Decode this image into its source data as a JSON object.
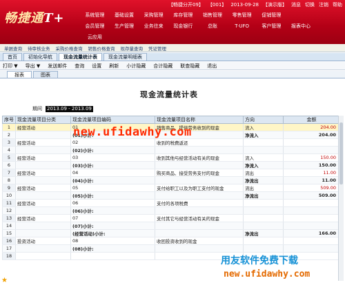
{
  "header": {
    "logo": "畅捷通",
    "logo_mark": "T+",
    "info": [
      "【畅捷分开09】",
      "【001】",
      "2013-09-28",
      "【演示版】",
      "消息",
      "切换",
      "注销",
      "帮助"
    ],
    "menu": [
      "系统管理",
      "基础设置",
      "采购管理",
      "库存管理",
      "销售管理",
      "零售管理",
      "促销管理",
      "会员管理",
      "生产管理",
      "业务往来",
      "现金银行",
      "总账",
      "T-UFO",
      "客户管理",
      "报表中心",
      "云应用"
    ]
  },
  "quick_links": [
    "单据查询",
    "待审核业务",
    "采购价格查询",
    "销售价格查询",
    "现存量查询",
    "凭证管理"
  ],
  "tabs": [
    "首页",
    "初始化导航",
    "现金流量统计表",
    "现金流量明细表"
  ],
  "active_tab": "现金流量统计表",
  "toolbar": {
    "print": "打印",
    "export": "导出",
    "send_mail": "发送邮件",
    "query": "查询",
    "settings": "设置",
    "refresh": "刷新",
    "hide_subtotal": "小计隐藏",
    "hide_total": "合计隐藏",
    "linked_query": "联查隐藏",
    "exit": "退出"
  },
  "view_tabs": [
    "报表",
    "图表"
  ],
  "report": {
    "title": "现金流量统计表",
    "period_label": "期间",
    "period_value": "2013.09 - 2013.09",
    "columns": [
      "序号",
      "现金流量项目分类",
      "现金流量项目编码",
      "现金流量项目名称",
      "方向",
      "金额"
    ],
    "rows": [
      {
        "seq": "1",
        "cat": "经营活动",
        "code": "01",
        "name": "销售商品、提供劳务收到的现金",
        "dir": "流入",
        "amt": "204.00",
        "type": "sel"
      },
      {
        "seq": "2",
        "cat": "",
        "code": "(01)小计:",
        "name": "",
        "dir": "净流入",
        "amt": "204.00",
        "type": "sub"
      },
      {
        "seq": "3",
        "cat": "经营活动",
        "code": "02",
        "name": "收到的税费返还",
        "dir": "",
        "amt": "",
        "type": "row"
      },
      {
        "seq": "4",
        "cat": "",
        "code": "(02)小计:",
        "name": "",
        "dir": "",
        "amt": "",
        "type": "sub"
      },
      {
        "seq": "5",
        "cat": "经营活动",
        "code": "03",
        "name": "收到其他与经营活动有关的现金",
        "dir": "流入",
        "amt": "150.00",
        "type": "row"
      },
      {
        "seq": "6",
        "cat": "",
        "code": "(03)小计:",
        "name": "",
        "dir": "净流入",
        "amt": "150.00",
        "type": "sub"
      },
      {
        "seq": "7",
        "cat": "经营活动",
        "code": "04",
        "name": "购买商品、接受劳务支付的现金",
        "dir": "流出",
        "amt": "11.00",
        "type": "row"
      },
      {
        "seq": "8",
        "cat": "",
        "code": "(04)小计:",
        "name": "",
        "dir": "净流出",
        "amt": "11.00",
        "type": "sub"
      },
      {
        "seq": "9",
        "cat": "经营活动",
        "code": "05",
        "name": "支付给职工以及为职工支付的现金",
        "dir": "流出",
        "amt": "509.00",
        "type": "row"
      },
      {
        "seq": "10",
        "cat": "",
        "code": "(05)小计:",
        "name": "",
        "dir": "净流出",
        "amt": "509.00",
        "type": "sub"
      },
      {
        "seq": "11",
        "cat": "经营活动",
        "code": "06",
        "name": "支付的各项税费",
        "dir": "",
        "amt": "",
        "type": "row"
      },
      {
        "seq": "12",
        "cat": "",
        "code": "(06)小计:",
        "name": "",
        "dir": "",
        "amt": "",
        "type": "sub"
      },
      {
        "seq": "13",
        "cat": "经营活动",
        "code": "07",
        "name": "支付其它与经营活动有关的现金",
        "dir": "",
        "amt": "",
        "type": "row"
      },
      {
        "seq": "14",
        "cat": "",
        "code": "(07)小计:",
        "name": "",
        "dir": "",
        "amt": "",
        "type": "sub"
      },
      {
        "seq": "15",
        "cat": "",
        "code": "(经营活动)小计:",
        "name": "",
        "dir": "净流出",
        "amt": "166.00",
        "type": "sub"
      },
      {
        "seq": "16",
        "cat": "投资活动",
        "code": "08",
        "name": "收回投资收到的现金",
        "dir": "",
        "amt": "",
        "type": "row"
      },
      {
        "seq": "17",
        "cat": "",
        "code": "(08)小计:",
        "name": "",
        "dir": "",
        "amt": "",
        "type": "sub"
      },
      {
        "seq": "18",
        "cat": "",
        "code": "",
        "name": "",
        "dir": "",
        "amt": "",
        "type": "row"
      }
    ]
  },
  "watermarks": {
    "center": "new.ufidawhy.com",
    "bottom_cn": "用友软件免费下载",
    "bottom_url": "new.ufidawhy.com"
  },
  "colors": {
    "header_red": "#c4001a",
    "amount_red": "#c20000",
    "amount_blue": "#3c3cb4",
    "watermark_red": "#ff2a00"
  }
}
